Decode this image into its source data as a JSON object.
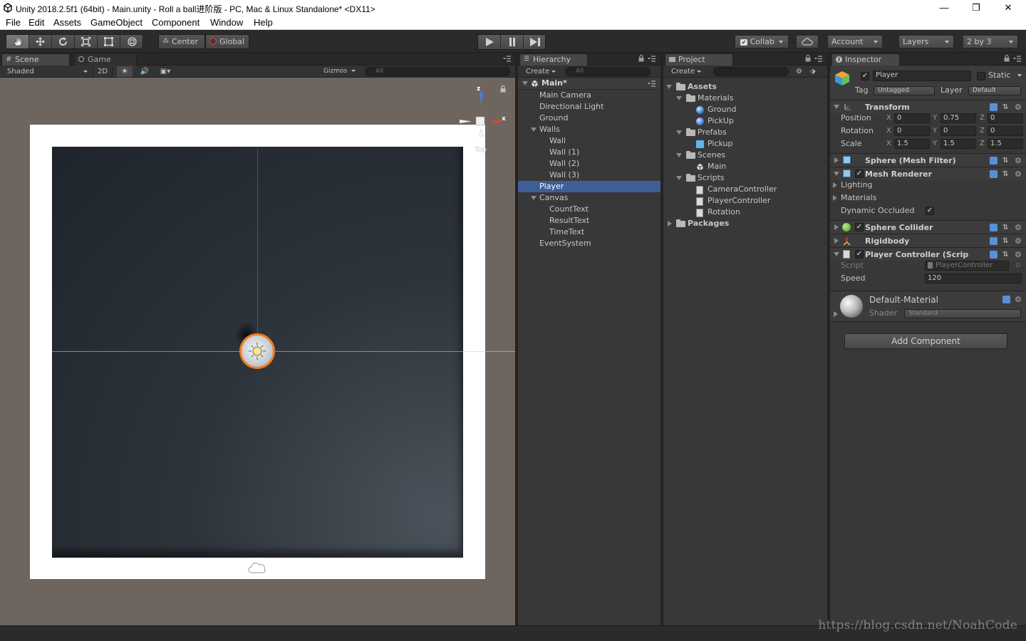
{
  "window": {
    "title": "Unity 2018.2.5f1 (64bit) - Main.unity - Roll a ball进阶版 - PC, Mac & Linux Standalone* <DX11>",
    "minimize": "—",
    "maximize": "❐",
    "close": "✕"
  },
  "menu": [
    "File",
    "Edit",
    "Assets",
    "GameObject",
    "Component",
    "Window",
    "Help"
  ],
  "toolbar": {
    "pivot_center": "Center",
    "pivot_global": "Global",
    "collab": "Collab",
    "account": "Account",
    "layers": "Layers",
    "layout": "2 by 3"
  },
  "scene": {
    "tab_scene": "Scene",
    "tab_game": "Game",
    "shading": "Shaded",
    "mode_2d": "2D",
    "gizmos": "Gizmos",
    "search_placeholder": "All",
    "gizmo_axis_z": "z",
    "gizmo_axis_x": "x",
    "gizmo_view": "Top"
  },
  "hierarchy": {
    "tab": "Hierarchy",
    "create": "Create",
    "search_placeholder": "All",
    "scene_name": "Main*",
    "items": [
      "Main Camera",
      "Directional Light",
      "Ground",
      "Walls",
      "Wall",
      "Wall (1)",
      "Wall (2)",
      "Wall (3)",
      "Player",
      "Canvas",
      "CountText",
      "ResultText",
      "TimeText",
      "EventSystem"
    ],
    "selected": "Player"
  },
  "project": {
    "tab": "Project",
    "create": "Create",
    "items": [
      "Assets",
      "Materials",
      "Ground",
      "PickUp",
      "Prefabs",
      "Pickup",
      "Scenes",
      "Main",
      "Scripts",
      "CameraController",
      "PlayerController",
      "Rotation",
      "Packages"
    ]
  },
  "inspector": {
    "tab": "Inspector",
    "object_name": "Player",
    "static_label": "Static",
    "tag_label": "Tag",
    "tag_value": "Untagged",
    "layer_label": "Layer",
    "layer_value": "Default",
    "transform": {
      "title": "Transform",
      "position_label": "Position",
      "rotation_label": "Rotation",
      "scale_label": "Scale",
      "axis_x": "X",
      "axis_y": "Y",
      "axis_z": "Z",
      "position": [
        "0",
        "0.75",
        "0"
      ],
      "rotation": [
        "0",
        "0",
        "0"
      ],
      "scale": [
        "1.5",
        "1.5",
        "1.5"
      ]
    },
    "mesh_filter": "Sphere (Mesh Filter)",
    "mesh_renderer": {
      "title": "Mesh Renderer",
      "lighting": "Lighting",
      "materials": "Materials",
      "dynamic_occluded": "Dynamic Occluded"
    },
    "sphere_collider": "Sphere Collider",
    "rigidbody": "Rigidbody",
    "player_controller": {
      "title": "Player Controller (Scrip",
      "script_label": "Script",
      "script_value": "PlayerController",
      "speed_label": "Speed",
      "speed_value": "120"
    },
    "material": {
      "name": "Default-Material",
      "shader_label": "Shader",
      "shader_value": "Standard"
    },
    "add_component": "Add Component"
  },
  "watermark": "https://blog.csdn.net/NoahCode",
  "colors": {
    "selection": "#3e5f96",
    "scene_background": "#6e655f",
    "player_outline": "#f07a1e"
  }
}
